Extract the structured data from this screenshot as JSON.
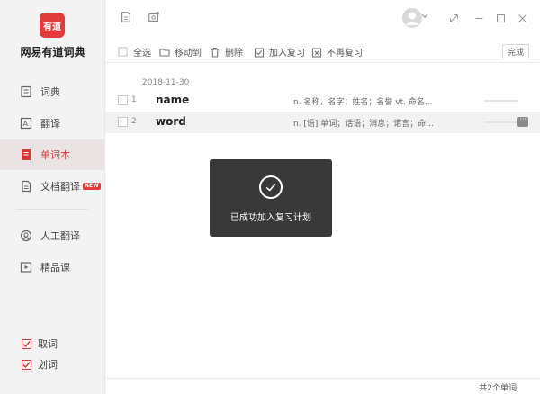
{
  "app": {
    "logo_text": "有道",
    "title": "网易有道词典"
  },
  "sidebar": {
    "items": [
      {
        "label": "词典",
        "icon": "book-icon"
      },
      {
        "label": "翻译",
        "icon": "translate-icon"
      },
      {
        "label": "单词本",
        "icon": "wordbook-icon"
      },
      {
        "label": "文档翻译",
        "icon": "document-icon",
        "badge": "NEW"
      },
      {
        "label": "人工翻译",
        "icon": "human-translate-icon"
      },
      {
        "label": "精品课",
        "icon": "course-icon"
      }
    ],
    "options": [
      {
        "label": "取词",
        "checked": true
      },
      {
        "label": "划词",
        "checked": true
      }
    ]
  },
  "toolbar": {
    "select_all": "全选",
    "move_to": "移动到",
    "delete": "删除",
    "add_review": "加入复习",
    "no_review": "不再复习",
    "done": "完成"
  },
  "wordlist": {
    "date": "2018-11-30",
    "rows": [
      {
        "index": "1",
        "word": "name",
        "definition": "n. 名称，名字；姓名；名誉  vt. 命名..."
      },
      {
        "index": "2",
        "word": "word",
        "definition": "n. [语] 单词；话语；消息；诺言；命..."
      }
    ]
  },
  "toast": {
    "message": "已成功加入复习计划"
  },
  "status": {
    "count": "共2个单词"
  },
  "colors": {
    "accent": "#d43a3a",
    "sidebar_bg": "#f3f3f3",
    "toast_bg": "#282828"
  }
}
